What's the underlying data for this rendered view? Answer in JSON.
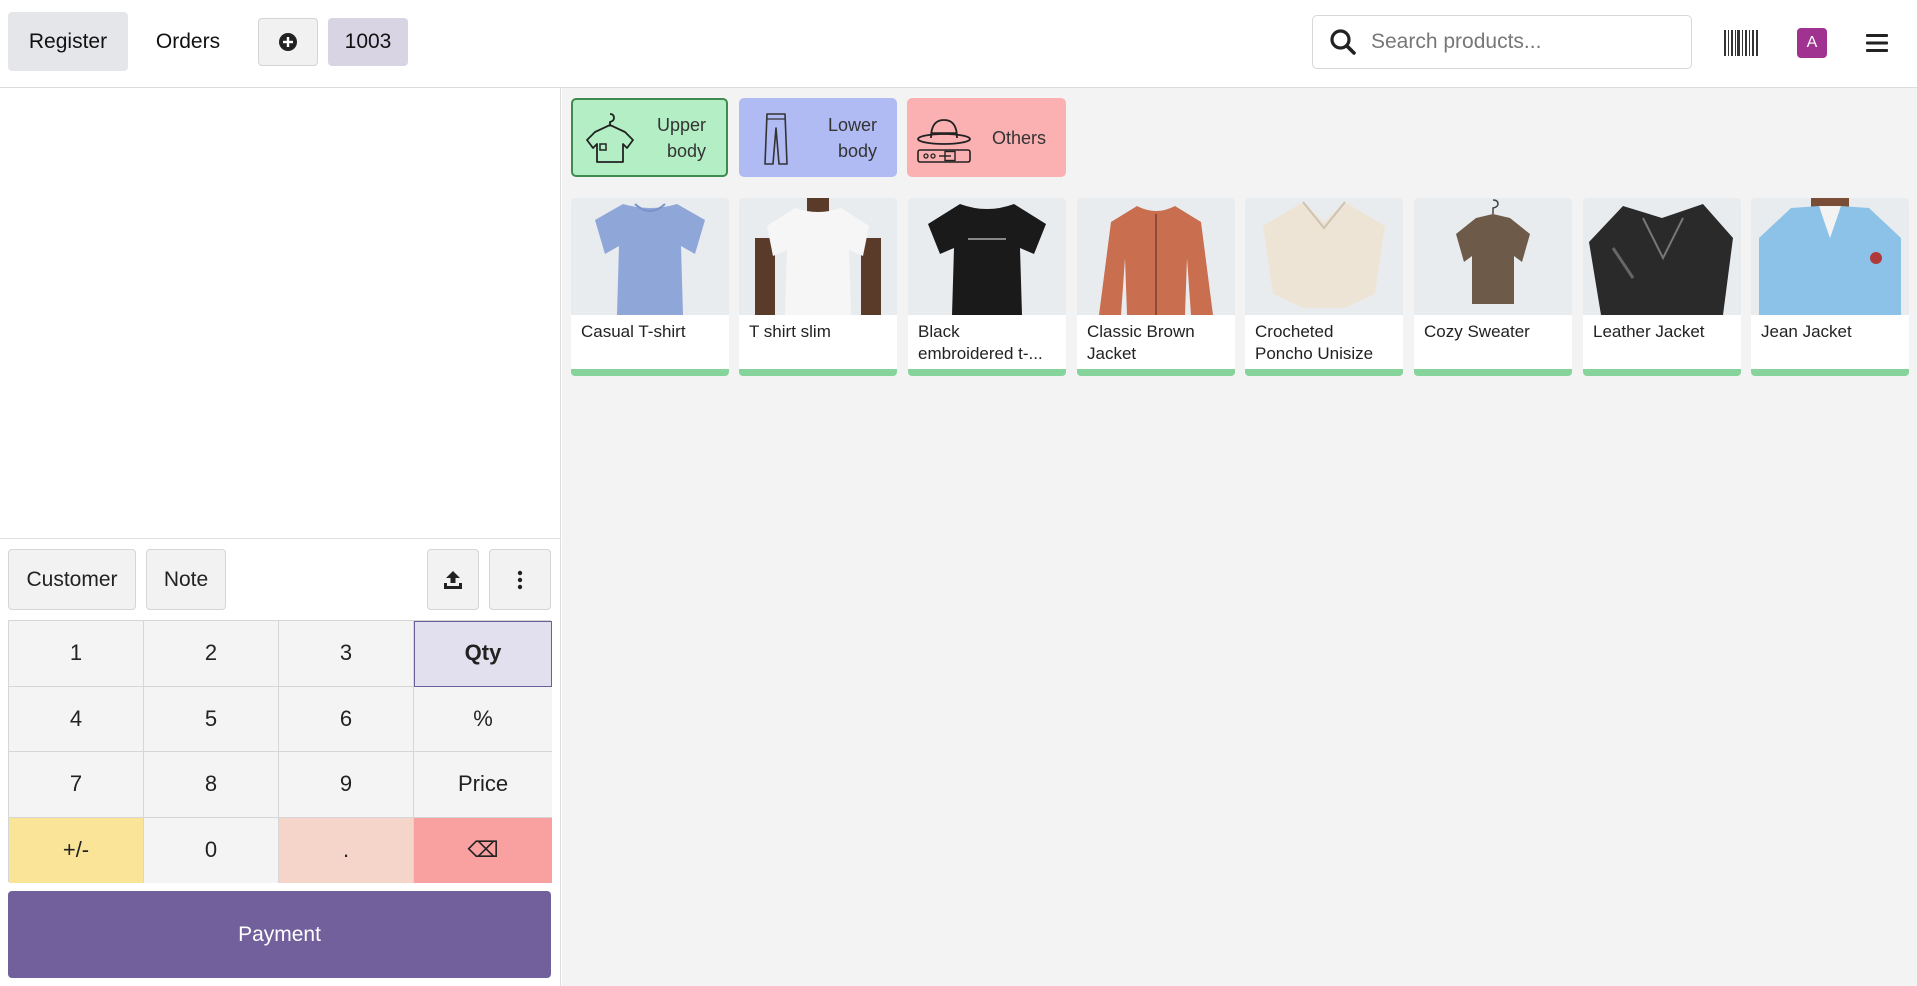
{
  "topbar": {
    "register_label": "Register",
    "orders_label": "Orders",
    "order_number": "1003",
    "search_placeholder": "Search products...",
    "avatar_initial": "A"
  },
  "controls": {
    "customer_label": "Customer",
    "note_label": "Note"
  },
  "numpad": {
    "keys": [
      "1",
      "2",
      "3",
      "Qty",
      "4",
      "5",
      "6",
      "%",
      "7",
      "8",
      "9",
      "Price",
      "+/-",
      "0",
      ".",
      "⌫"
    ]
  },
  "payment_label": "Payment",
  "categories": [
    {
      "name": "Upper body",
      "line1": "Upper",
      "line2": "body",
      "color": "#b3eec4"
    },
    {
      "name": "Lower body",
      "line1": "Lower",
      "line2": "body",
      "color": "#b0baf3"
    },
    {
      "name": "Others",
      "line1": "Others",
      "line2": "",
      "color": "#fbb0b2"
    }
  ],
  "products": [
    {
      "name": "Casual T-shirt",
      "color": "#8fa6d9"
    },
    {
      "name": "T shirt slim",
      "color": "#f4f4f4"
    },
    {
      "name": "Black embroidered t-...",
      "color": "#1a1a1a"
    },
    {
      "name": "Classic Brown Jacket",
      "color": "#c96e4f"
    },
    {
      "name": "Crocheted Poncho Unisize",
      "color": "#eee4d6"
    },
    {
      "name": "Cozy Sweater",
      "color": "#6d5a48"
    },
    {
      "name": "Leather Jacket",
      "color": "#2a2a2a"
    },
    {
      "name": "Jean Jacket",
      "color": "#8cc2e8"
    }
  ],
  "colors": {
    "accent": "#71609b",
    "stock_bar": "#86d49b"
  }
}
